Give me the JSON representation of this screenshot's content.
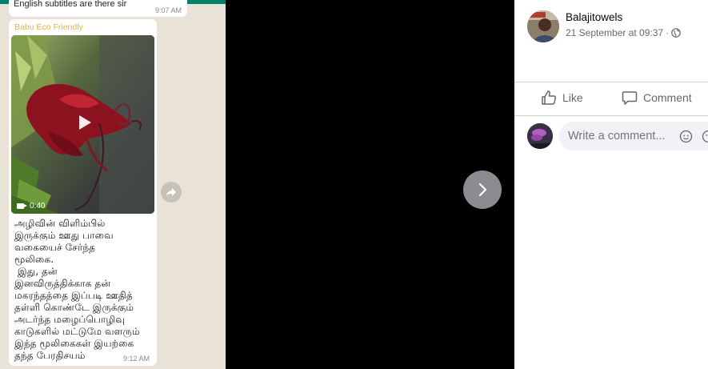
{
  "whatsapp": {
    "prev_message": "English subtitles are there sir",
    "prev_time": "9:07 AM",
    "sender": "Babu Eco Friendly",
    "video_duration": "0:40",
    "message_lines": [
      "அழிவின் விளிம்பில்",
      "இருக்கும் ஊது பாவை",
      "வகையைச் சேர்ந்த",
      "மூலிகை.",
      " இது, தன்",
      "இனவிருத்திக்காக தன்",
      "மகரந்தத்தை இப்படி ஊதித்",
      "தள்ளி கொண்டே இருக்கும்",
      "அடர்ந்த மழைப்பொழிவு",
      "காடுகளில் மட்டுமே வளரும்",
      "இந்த மூலிகைகள் இயற்கை",
      "தந்த பேரதிசயம்"
    ],
    "message_time": "9:12 AM"
  },
  "post": {
    "author": "Balajitowels",
    "timestamp": "21 September at 09:37",
    "separator": "·",
    "privacy_icon": "globe-icon"
  },
  "actions": {
    "like_label": "Like",
    "comment_label": "Comment"
  },
  "comment_box": {
    "placeholder": "Write a comment..."
  },
  "colors": {
    "whatsapp_bg": "#e9e2d6",
    "whatsapp_header": "#008069",
    "sender_color": "#e6b43c",
    "fb_secondary_text": "#65676b",
    "next_button": "#8a8c8f"
  }
}
